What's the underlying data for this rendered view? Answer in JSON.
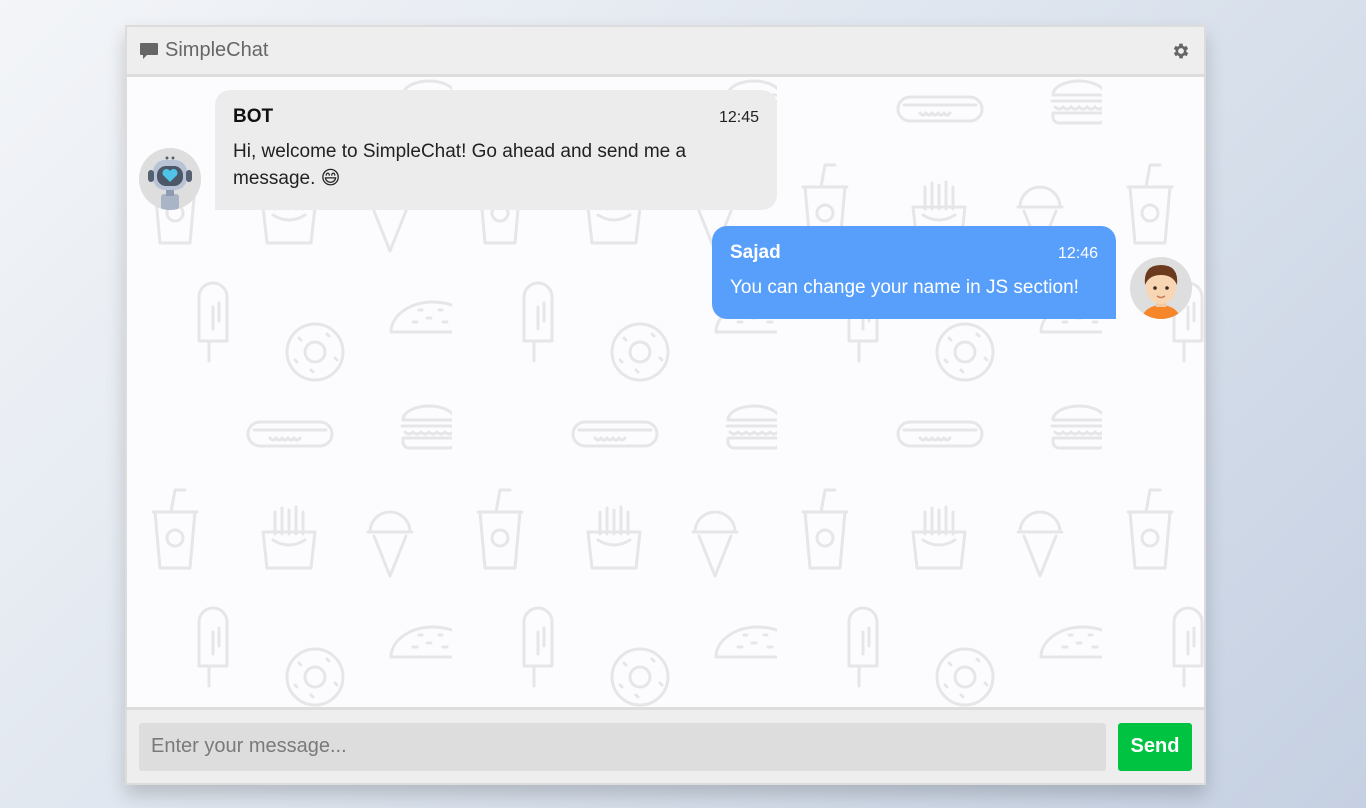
{
  "header": {
    "title": "SimpleChat",
    "icon": "comment-icon",
    "settings_icon": "gear-icon"
  },
  "messages": [
    {
      "sender": "BOT",
      "time": "12:45",
      "text": "Hi, welcome to SimpleChat! Go ahead and send me a message. 😄",
      "side": "left",
      "avatar": "robot-avatar"
    },
    {
      "sender": "Sajad",
      "time": "12:46",
      "text": "You can change your name in JS section!",
      "side": "right",
      "avatar": "boy-avatar"
    }
  ],
  "composer": {
    "placeholder": "Enter your message...",
    "value": "",
    "send_label": "Send"
  },
  "colors": {
    "bot_bubble": "#ececec",
    "user_bubble": "#579ffb",
    "send_button": "#00c441",
    "header_bg": "#eeeeee"
  }
}
